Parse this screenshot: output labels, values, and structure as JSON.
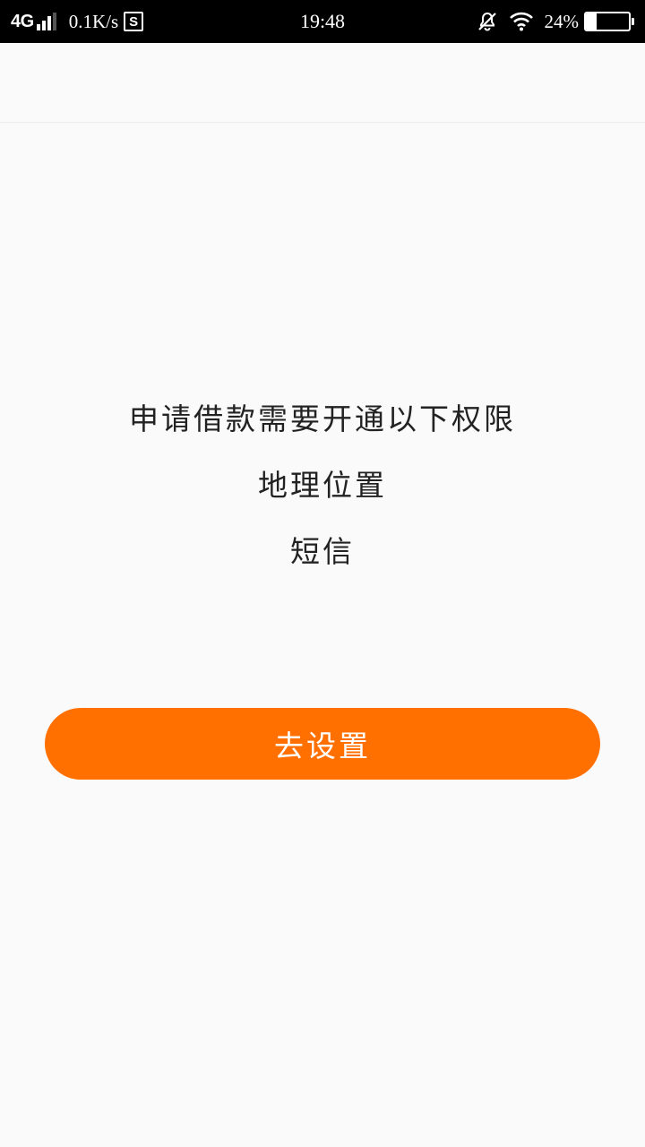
{
  "status_bar": {
    "network": "4G",
    "speed": "0.1K/s",
    "s_badge": "S",
    "time": "19:48",
    "battery_percent": "24%",
    "battery_level": 0.24,
    "icons": [
      "signal-icon",
      "s-notification-icon",
      "mute-bell-icon",
      "wifi-icon",
      "battery-icon"
    ]
  },
  "permission": {
    "title": "申请借款需要开通以下权限",
    "items": [
      "地理位置",
      "短信"
    ]
  },
  "actions": {
    "go_settings_label": "去设置"
  },
  "colors": {
    "accent": "#ff7000",
    "background": "#fafafa",
    "text": "#222222"
  }
}
